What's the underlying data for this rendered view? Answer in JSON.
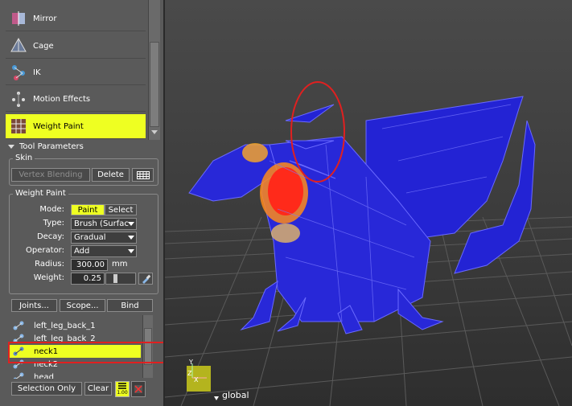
{
  "tools": {
    "items": [
      {
        "label": "Mirror",
        "icon": "mirror-icon"
      },
      {
        "label": "Cage",
        "icon": "cage-icon"
      },
      {
        "label": "IK",
        "icon": "ik-icon"
      },
      {
        "label": "Motion Effects",
        "icon": "motion-effects-icon"
      },
      {
        "label": "Weight Paint",
        "icon": "weight-paint-icon",
        "active": true
      }
    ]
  },
  "tool_parameters": {
    "title": "Tool Parameters"
  },
  "skin": {
    "title": "Skin",
    "vertex_blending_label": "Vertex Blending",
    "delete_label": "Delete"
  },
  "weight_paint": {
    "title": "Weight Paint",
    "mode_label": "Mode:",
    "mode_paint": "Paint",
    "mode_select": "Select",
    "type_label": "Type:",
    "type_value": "Brush (Surfac",
    "decay_label": "Decay:",
    "decay_value": "Gradual",
    "operator_label": "Operator:",
    "operator_value": "Add",
    "radius_label": "Radius:",
    "radius_value": "300.00",
    "radius_unit": "mm",
    "weight_label": "Weight:",
    "weight_value": "0.25",
    "weight_level": 0.25
  },
  "joint_buttons": {
    "joints": "Joints...",
    "scope": "Scope...",
    "bind": "Bind"
  },
  "joints": [
    {
      "label": "left_leg_back_1"
    },
    {
      "label": "left_leg_back_2"
    },
    {
      "label": "neck1",
      "selected": true
    },
    {
      "label": "neck2"
    },
    {
      "label": "head"
    }
  ],
  "bottom_buttons": {
    "selection_only": "Selection Only",
    "clear": "Clear",
    "value_icon_text": "1.00"
  },
  "viewport": {
    "axis_y": "Y",
    "axis_z": "Z",
    "axis_x": "X",
    "coord_mode": "global",
    "colors": {
      "mesh_blue": "#2a2ad8",
      "weight_red": "#ff2a1a",
      "highlight_yellow": "#eeff22",
      "annotation_red": "#e02020"
    }
  }
}
